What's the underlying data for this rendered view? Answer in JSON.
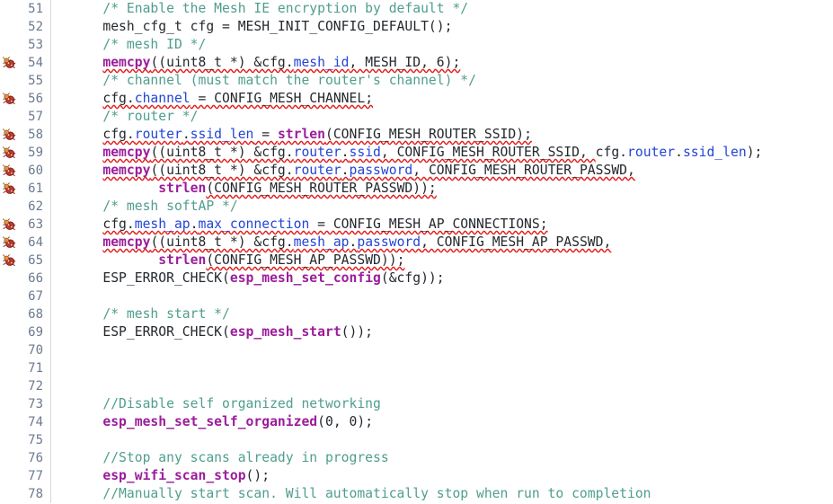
{
  "editor": {
    "name": "source-code-view",
    "language": "C",
    "colors": {
      "background": "#ffffff",
      "line_number": "#6b7a90",
      "gutter_divider": "#d8d8d8",
      "comment": "#4f9e8e",
      "function": "#9b1d9b",
      "member": "#2145d8",
      "plain_text": "#24292e",
      "error_squiggle": "#e02020"
    },
    "first_visible_line": 51,
    "last_visible_line": 78,
    "marker_icon_name": "bug-error-marker-icon"
  },
  "lines": [
    {
      "number": "51",
      "marker": false,
      "tokens": [
        {
          "text": "    ",
          "cls": "t-plain"
        },
        {
          "text": "/* Enable the Mesh IE encryption by default */",
          "cls": "t-comment"
        }
      ]
    },
    {
      "number": "52",
      "marker": false,
      "tokens": [
        {
          "text": "    mesh_cfg_t cfg = MESH_INIT_CONFIG_DEFAULT();",
          "cls": "t-plain"
        }
      ]
    },
    {
      "number": "53",
      "marker": false,
      "tokens": [
        {
          "text": "    ",
          "cls": "t-plain"
        },
        {
          "text": "/* mesh ID */",
          "cls": "t-comment"
        }
      ]
    },
    {
      "number": "54",
      "marker": true,
      "tokens": [
        {
          "text": "    ",
          "cls": "t-plain"
        },
        {
          "text": "memcpy",
          "cls": "t-func sq"
        },
        {
          "text": "((uint8_t *) &cfg.",
          "cls": "t-plain sq"
        },
        {
          "text": "mesh_id",
          "cls": "t-member sq"
        },
        {
          "text": ", MESH_ID, 6);",
          "cls": "t-plain sq"
        }
      ]
    },
    {
      "number": "55",
      "marker": false,
      "tokens": [
        {
          "text": "    ",
          "cls": "t-plain"
        },
        {
          "text": "/* channel (must match the router's channel) */",
          "cls": "t-comment"
        }
      ]
    },
    {
      "number": "56",
      "marker": true,
      "tokens": [
        {
          "text": "    ",
          "cls": "t-plain"
        },
        {
          "text": "cfg.",
          "cls": "t-plain sq"
        },
        {
          "text": "channel",
          "cls": "t-member sq"
        },
        {
          "text": " = CONFIG_MESH_CHANNEL;",
          "cls": "t-plain sq"
        }
      ]
    },
    {
      "number": "57",
      "marker": false,
      "tokens": [
        {
          "text": "    ",
          "cls": "t-plain"
        },
        {
          "text": "/* router */",
          "cls": "t-comment"
        }
      ]
    },
    {
      "number": "58",
      "marker": true,
      "tokens": [
        {
          "text": "    ",
          "cls": "t-plain"
        },
        {
          "text": "cfg.",
          "cls": "t-plain sq"
        },
        {
          "text": "router",
          "cls": "t-member sq"
        },
        {
          "text": ".",
          "cls": "t-plain sq"
        },
        {
          "text": "ssid_len",
          "cls": "t-member sq"
        },
        {
          "text": " = ",
          "cls": "t-plain sq"
        },
        {
          "text": "strlen",
          "cls": "t-func sq"
        },
        {
          "text": "(CONFIG_MESH_ROUTER_SSID);",
          "cls": "t-plain sq"
        }
      ]
    },
    {
      "number": "59",
      "marker": true,
      "tokens": [
        {
          "text": "    ",
          "cls": "t-plain"
        },
        {
          "text": "memcpy",
          "cls": "t-func sq"
        },
        {
          "text": "((uint8_t *) &cfg.",
          "cls": "t-plain sq"
        },
        {
          "text": "router",
          "cls": "t-member sq"
        },
        {
          "text": ".",
          "cls": "t-plain sq"
        },
        {
          "text": "ssid",
          "cls": "t-member sq"
        },
        {
          "text": ", CONFIG_MESH_ROUTER_SSID, ",
          "cls": "t-plain sq"
        },
        {
          "text": "cfg.",
          "cls": "t-plain"
        },
        {
          "text": "router",
          "cls": "t-member"
        },
        {
          "text": ".",
          "cls": "t-plain"
        },
        {
          "text": "ssid_len",
          "cls": "t-member"
        },
        {
          "text": ");",
          "cls": "t-plain"
        }
      ]
    },
    {
      "number": "60",
      "marker": true,
      "tokens": [
        {
          "text": "    ",
          "cls": "t-plain"
        },
        {
          "text": "memcpy",
          "cls": "t-func sq"
        },
        {
          "text": "((uint8_t *) &cfg.",
          "cls": "t-plain sq"
        },
        {
          "text": "router",
          "cls": "t-member sq"
        },
        {
          "text": ".",
          "cls": "t-plain sq"
        },
        {
          "text": "password",
          "cls": "t-member sq"
        },
        {
          "text": ", CONFIG_MESH_ROUTER_PASSWD,",
          "cls": "t-plain sq"
        }
      ]
    },
    {
      "number": "61",
      "marker": true,
      "tokens": [
        {
          "text": "           ",
          "cls": "t-plain"
        },
        {
          "text": "strlen",
          "cls": "t-func"
        },
        {
          "text": "(CONFIG_MESH_ROUTER_PASSWD));",
          "cls": "t-plain sq"
        }
      ]
    },
    {
      "number": "62",
      "marker": false,
      "tokens": [
        {
          "text": "    ",
          "cls": "t-plain"
        },
        {
          "text": "/* mesh softAP */",
          "cls": "t-comment"
        }
      ]
    },
    {
      "number": "63",
      "marker": true,
      "tokens": [
        {
          "text": "    ",
          "cls": "t-plain"
        },
        {
          "text": "cfg.",
          "cls": "t-plain sq"
        },
        {
          "text": "mesh_ap",
          "cls": "t-member sq"
        },
        {
          "text": ".",
          "cls": "t-plain sq"
        },
        {
          "text": "max_connection",
          "cls": "t-member sq"
        },
        {
          "text": " = CONFIG_MESH_AP_CONNECTIONS;",
          "cls": "t-plain sq"
        }
      ]
    },
    {
      "number": "64",
      "marker": true,
      "tokens": [
        {
          "text": "    ",
          "cls": "t-plain"
        },
        {
          "text": "memcpy",
          "cls": "t-func sq"
        },
        {
          "text": "((uint8_t *) &cfg.",
          "cls": "t-plain sq"
        },
        {
          "text": "mesh_ap",
          "cls": "t-member sq"
        },
        {
          "text": ".",
          "cls": "t-plain sq"
        },
        {
          "text": "password",
          "cls": "t-member sq"
        },
        {
          "text": ", CONFIG_MESH_AP_PASSWD,",
          "cls": "t-plain sq"
        }
      ]
    },
    {
      "number": "65",
      "marker": true,
      "tokens": [
        {
          "text": "           ",
          "cls": "t-plain"
        },
        {
          "text": "strlen",
          "cls": "t-func"
        },
        {
          "text": "(CONFIG_MESH_AP_PASSWD));",
          "cls": "t-plain sq"
        }
      ]
    },
    {
      "number": "66",
      "marker": false,
      "tokens": [
        {
          "text": "    ESP_ERROR_CHECK(",
          "cls": "t-plain"
        },
        {
          "text": "esp_mesh_set_config",
          "cls": "t-func"
        },
        {
          "text": "(&cfg));",
          "cls": "t-plain"
        }
      ]
    },
    {
      "number": "67",
      "marker": false,
      "tokens": []
    },
    {
      "number": "68",
      "marker": false,
      "tokens": [
        {
          "text": "    ",
          "cls": "t-plain"
        },
        {
          "text": "/* mesh start */",
          "cls": "t-comment"
        }
      ]
    },
    {
      "number": "69",
      "marker": false,
      "tokens": [
        {
          "text": "    ESP_ERROR_CHECK(",
          "cls": "t-plain"
        },
        {
          "text": "esp_mesh_start",
          "cls": "t-func"
        },
        {
          "text": "());",
          "cls": "t-plain"
        }
      ]
    },
    {
      "number": "70",
      "marker": false,
      "tokens": []
    },
    {
      "number": "71",
      "marker": false,
      "tokens": []
    },
    {
      "number": "72",
      "marker": false,
      "tokens": []
    },
    {
      "number": "73",
      "marker": false,
      "tokens": [
        {
          "text": "    ",
          "cls": "t-plain"
        },
        {
          "text": "//Disable self organized networking",
          "cls": "t-comment"
        }
      ]
    },
    {
      "number": "74",
      "marker": false,
      "tokens": [
        {
          "text": "    ",
          "cls": "t-plain"
        },
        {
          "text": "esp_mesh_set_self_organized",
          "cls": "t-func"
        },
        {
          "text": "(0, 0);",
          "cls": "t-plain"
        }
      ]
    },
    {
      "number": "75",
      "marker": false,
      "tokens": []
    },
    {
      "number": "76",
      "marker": false,
      "tokens": [
        {
          "text": "    ",
          "cls": "t-plain"
        },
        {
          "text": "//Stop any scans already in progress",
          "cls": "t-comment"
        }
      ]
    },
    {
      "number": "77",
      "marker": false,
      "tokens": [
        {
          "text": "    ",
          "cls": "t-plain"
        },
        {
          "text": "esp_wifi_scan_stop",
          "cls": "t-func"
        },
        {
          "text": "();",
          "cls": "t-plain"
        }
      ]
    },
    {
      "number": "78",
      "marker": false,
      "tokens": [
        {
          "text": "    ",
          "cls": "t-plain"
        },
        {
          "text": "//Manually start scan. Will automatically stop when run to completion",
          "cls": "t-comment"
        }
      ]
    }
  ]
}
